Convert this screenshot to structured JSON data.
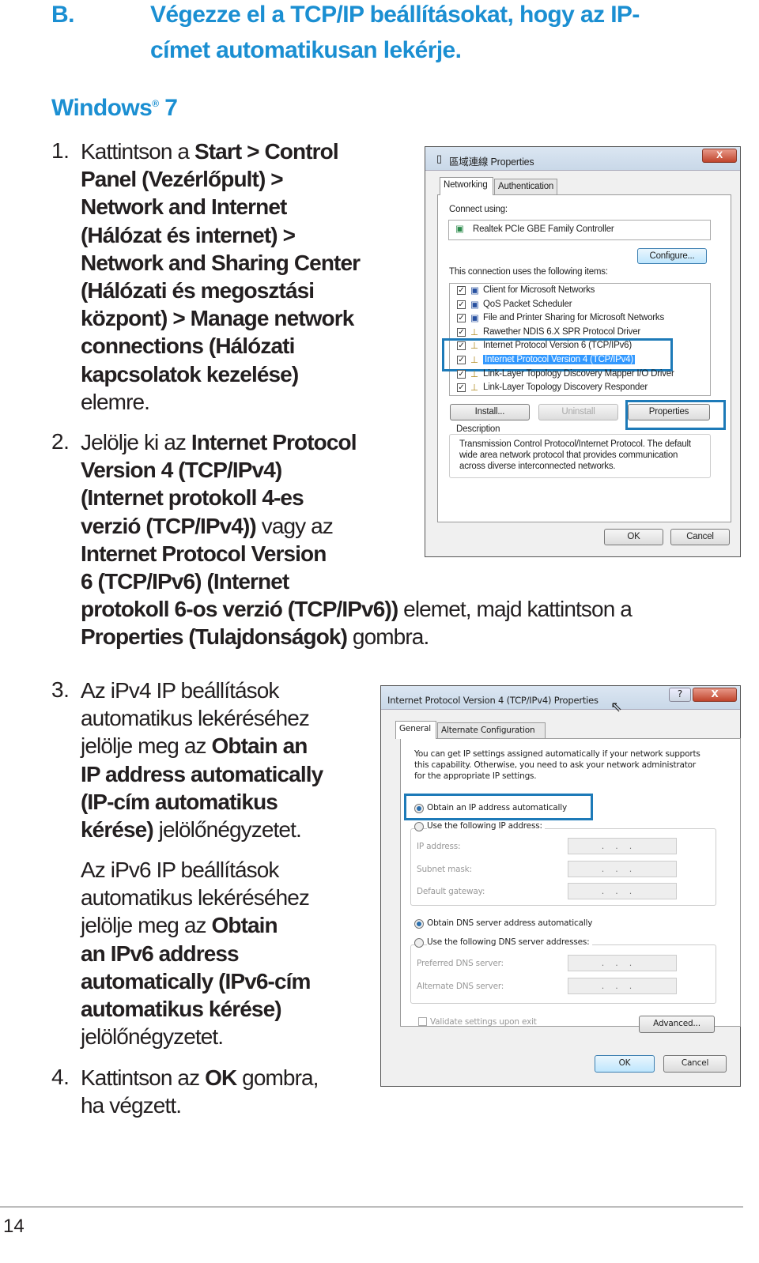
{
  "section": {
    "letter": "B.",
    "title_lines": [
      "Végezze el a TCP/IP beállításokat, hogy az IP-",
      "címet automatikusan lekérje."
    ]
  },
  "os": {
    "name": "Windows",
    "reg": "®",
    "version": "7"
  },
  "steps": [
    {
      "num": "1.",
      "lines": [
        [
          {
            "t": "Kattintson a "
          },
          {
            "t": "Start > Control",
            "b": true
          }
        ],
        [
          {
            "t": "Panel (Vezérlőpult) >",
            "b": true
          }
        ],
        [
          {
            "t": "Network and Internet",
            "b": true
          }
        ],
        [
          {
            "t": "(Hálózat és internet) >",
            "b": true
          }
        ],
        [
          {
            "t": "Network and Sharing Center",
            "b": true
          }
        ],
        [
          {
            "t": "(Hálózati és megosztási",
            "b": true
          }
        ],
        [
          {
            "t": "központ) > Manage network",
            "b": true
          }
        ],
        [
          {
            "t": "connections (Hálózati",
            "b": true
          }
        ],
        [
          {
            "t": "kapcsolatok kezelése)",
            "b": true
          }
        ],
        [
          {
            "t": "elemre."
          }
        ]
      ]
    },
    {
      "num": "2.",
      "lines": [
        [
          {
            "t": "Jelölje ki az "
          },
          {
            "t": "Internet Protocol",
            "b": true
          }
        ],
        [
          {
            "t": "Version 4 (TCP/IPv4)",
            "b": true
          }
        ],
        [
          {
            "t": "(Internet protokoll 4-es",
            "b": true
          }
        ],
        [
          {
            "t": "verzió (TCP/IPv4))",
            "b": true
          },
          {
            "t": " vagy az"
          }
        ],
        [
          {
            "t": "Internet Protocol Version",
            "b": true
          }
        ],
        [
          {
            "t": "6 (TCP/IPv6) (Internet",
            "b": true
          }
        ],
        [
          {
            "t": "protokoll 6-os verzió (TCP/IPv6))",
            "b": true
          },
          {
            "t": " elemet, majd kattintson a"
          }
        ],
        [
          {
            "t": "Properties (Tulajdonságok)",
            "b": true
          },
          {
            "t": " gombra."
          }
        ]
      ]
    },
    {
      "num": "3.",
      "lines": [
        [
          {
            "t": "Az iPv4 IP beállítások"
          }
        ],
        [
          {
            "t": "automatikus lekéréséhez"
          }
        ],
        [
          {
            "t": "jelölje meg az "
          },
          {
            "t": "Obtain an",
            "b": true
          }
        ],
        [
          {
            "t": "IP address automatically",
            "b": true
          }
        ],
        [
          {
            "t": "(IP-cím automatikus",
            "b": true
          }
        ],
        [
          {
            "t": "kérése)",
            "b": true
          },
          {
            "t": " jelölőnégyzetet."
          }
        ]
      ]
    },
    {
      "num": "",
      "lines": [
        [
          {
            "t": "Az iPv6 IP beállítások"
          }
        ],
        [
          {
            "t": "automatikus lekéréséhez"
          }
        ],
        [
          {
            "t": "jelölje meg az "
          },
          {
            "t": "Obtain",
            "b": true
          }
        ],
        [
          {
            "t": "an IPv6 address",
            "b": true
          }
        ],
        [
          {
            "t": "automatically (IPv6-cím",
            "b": true
          }
        ],
        [
          {
            "t": "automatikus kérése)",
            "b": true
          }
        ],
        [
          {
            "t": "jelölőnégyzetet."
          }
        ]
      ]
    },
    {
      "num": "4.",
      "lines": [
        [
          {
            "t": "Kattintson az "
          },
          {
            "t": "OK",
            "b": true
          },
          {
            "t": " gombra,"
          }
        ],
        [
          {
            "t": "ha végzett."
          }
        ]
      ]
    }
  ],
  "dialog1": {
    "title": "區域連線 Properties",
    "close": "X",
    "tabs": [
      "Networking",
      "Authentication"
    ],
    "connect_using": "Connect using:",
    "adapter": "Realtek PCIe GBE Family Controller",
    "configure": "Configure...",
    "items_label": "This connection uses the following items:",
    "items": [
      "Client for Microsoft Networks",
      "QoS Packet Scheduler",
      "File and Printer Sharing for Microsoft Networks",
      "Rawether NDIS 6.X SPR Protocol Driver",
      "Internet Protocol Version 6 (TCP/IPv6)",
      "Internet Protocol Version 4 (TCP/IPv4)",
      "Link-Layer Topology Discovery Mapper I/O Driver",
      "Link-Layer Topology Discovery Responder"
    ],
    "install": "Install...",
    "uninstall": "Uninstall",
    "properties": "Properties",
    "description_label": "Description",
    "description_lines": [
      "Transmission Control Protocol/Internet Protocol. The default",
      "wide area network protocol that provides communication",
      "across diverse interconnected networks."
    ],
    "ok": "OK",
    "cancel": "Cancel",
    "highlight_color": "#1d7ab8"
  },
  "dialog2": {
    "title": "Internet Protocol Version 4 (TCP/IPv4) Properties",
    "help": "?",
    "close": "X",
    "tabs": [
      "General",
      "Alternate Configuration"
    ],
    "intro_lines": [
      "You can get IP settings assigned automatically if your network supports",
      "this capability. Otherwise, you need to ask your network administrator",
      "for the appropriate IP settings."
    ],
    "obtain_ip": "Obtain an IP address automatically",
    "use_ip": "Use the following IP address:",
    "ip_fields": [
      "IP address:",
      "Subnet mask:",
      "Default gateway:"
    ],
    "obtain_dns": "Obtain DNS server address automatically",
    "use_dns": "Use the following DNS server addresses:",
    "dns_fields": [
      "Preferred DNS server:",
      "Alternate DNS server:"
    ],
    "ip_placeholder": "...",
    "validate": "Validate settings upon exit",
    "advanced": "Advanced...",
    "ok": "OK",
    "cancel": "Cancel"
  },
  "footer": {
    "page_number": "14"
  }
}
